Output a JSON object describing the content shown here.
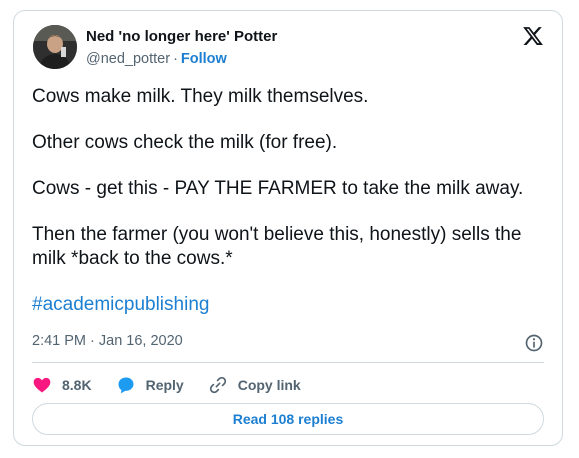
{
  "author": {
    "name": "Ned 'no longer here' Potter",
    "handle": "@ned_potter",
    "separator": "·",
    "follow_label": "Follow"
  },
  "tweet": {
    "paragraphs": [
      "Cows make milk. They milk themselves.",
      "Other cows check the milk (for free).",
      "Cows - get this - PAY THE FARMER to take the milk away.",
      "Then the farmer (you won't believe this, honestly) sells the milk *back to the cows.*"
    ],
    "hashtag": "#academicpublishing",
    "timestamp": "2:41 PM · Jan 16, 2020"
  },
  "actions": {
    "likes": "8.8K",
    "reply_label": "Reply",
    "copy_link_label": "Copy link"
  },
  "read_replies_label": "Read 108 replies",
  "colors": {
    "accent": "#1d7fd1",
    "like": "#f91880",
    "reply_bubble": "#1d9bf0",
    "muted": "#536471"
  },
  "icons": [
    "x-logo-icon",
    "info-icon",
    "heart-icon",
    "reply-bubble-icon",
    "link-icon"
  ]
}
